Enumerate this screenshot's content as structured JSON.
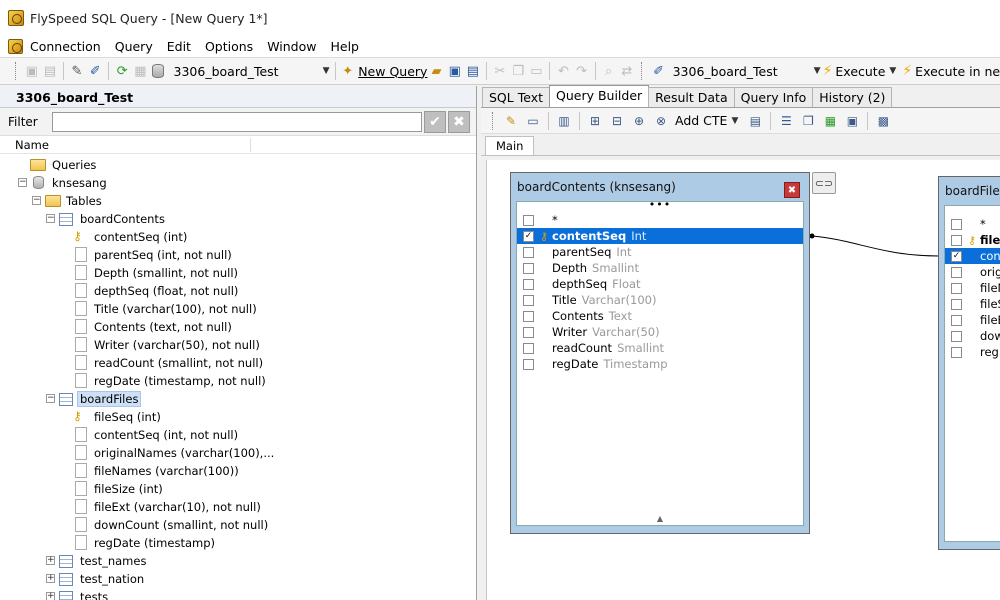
{
  "window": {
    "title": "FlySpeed SQL Query  - [New Query 1*]"
  },
  "menu": [
    "Connection",
    "Query",
    "Edit",
    "Options",
    "Window",
    "Help"
  ],
  "toolbar": {
    "connection_combo": "3306_board_Test",
    "new_query_label": "New Query",
    "query_connection_combo": "3306_board_Test",
    "execute_label": "Execute",
    "execute_in_label": "Execute in ne"
  },
  "left_panel": {
    "title": "3306_board_Test",
    "filter_label": "Filter",
    "filter_value": "",
    "column_header": "Name",
    "tree": {
      "queries": "Queries",
      "database": "knsesang",
      "tables": "Tables",
      "board_contents": {
        "name": "boardContents",
        "fields": [
          "contentSeq (int)",
          "parentSeq (int, not null)",
          "Depth (smallint, not null)",
          "depthSeq (float, not null)",
          "Title (varchar(100), not null)",
          "Contents (text, not null)",
          "Writer (varchar(50), not null)",
          "readCount (smallint, not null)",
          "regDate (timestamp, not null)"
        ]
      },
      "board_files": {
        "name": "boardFiles",
        "fields": [
          "fileSeq (int)",
          "contentSeq (int, not null)",
          "originalNames (varchar(100),...",
          "fileNames (varchar(100))",
          "fileSize (int)",
          "fileExt (varchar(10), not null)",
          "downCount (smallint, not null)",
          "regDate (timestamp)"
        ]
      },
      "other_tables": [
        "test_names",
        "test_nation",
        "tests"
      ]
    }
  },
  "tabs": [
    "SQL Text",
    "Query Builder",
    "Result Data",
    "Query Info",
    "History (2)"
  ],
  "active_tab": "Query Builder",
  "query_toolbar": {
    "add_cte_label": "Add CTE"
  },
  "subtabs": [
    "Main"
  ],
  "designer": {
    "box1": {
      "title": "boardContents (knsesang)",
      "top_dots": "•••",
      "fields": [
        {
          "name": "*",
          "type": "",
          "checked": false
        },
        {
          "name": "contentSeq",
          "type": "Int",
          "checked": true,
          "key": true,
          "selected": true
        },
        {
          "name": "parentSeq",
          "type": "Int",
          "checked": false
        },
        {
          "name": "Depth",
          "type": "Smallint",
          "checked": false
        },
        {
          "name": "depthSeq",
          "type": "Float",
          "checked": false
        },
        {
          "name": "Title",
          "type": "Varchar(100)",
          "checked": false
        },
        {
          "name": "Contents",
          "type": "Text",
          "checked": false
        },
        {
          "name": "Writer",
          "type": "Varchar(50)",
          "checked": false
        },
        {
          "name": "readCount",
          "type": "Smallint",
          "checked": false
        },
        {
          "name": "regDate",
          "type": "Timestamp",
          "checked": false
        }
      ]
    },
    "box2": {
      "title": "boardFiles",
      "fields": [
        {
          "name": "*",
          "checked": false
        },
        {
          "name": "fileS",
          "checked": false,
          "key": true
        },
        {
          "name": "conte",
          "checked": true,
          "selected": true
        },
        {
          "name": "origin",
          "checked": false
        },
        {
          "name": "fileNa",
          "checked": false
        },
        {
          "name": "fileSiz",
          "checked": false
        },
        {
          "name": "fileEx",
          "checked": false
        },
        {
          "name": "down",
          "checked": false
        },
        {
          "name": "regDa",
          "checked": false
        }
      ]
    }
  }
}
